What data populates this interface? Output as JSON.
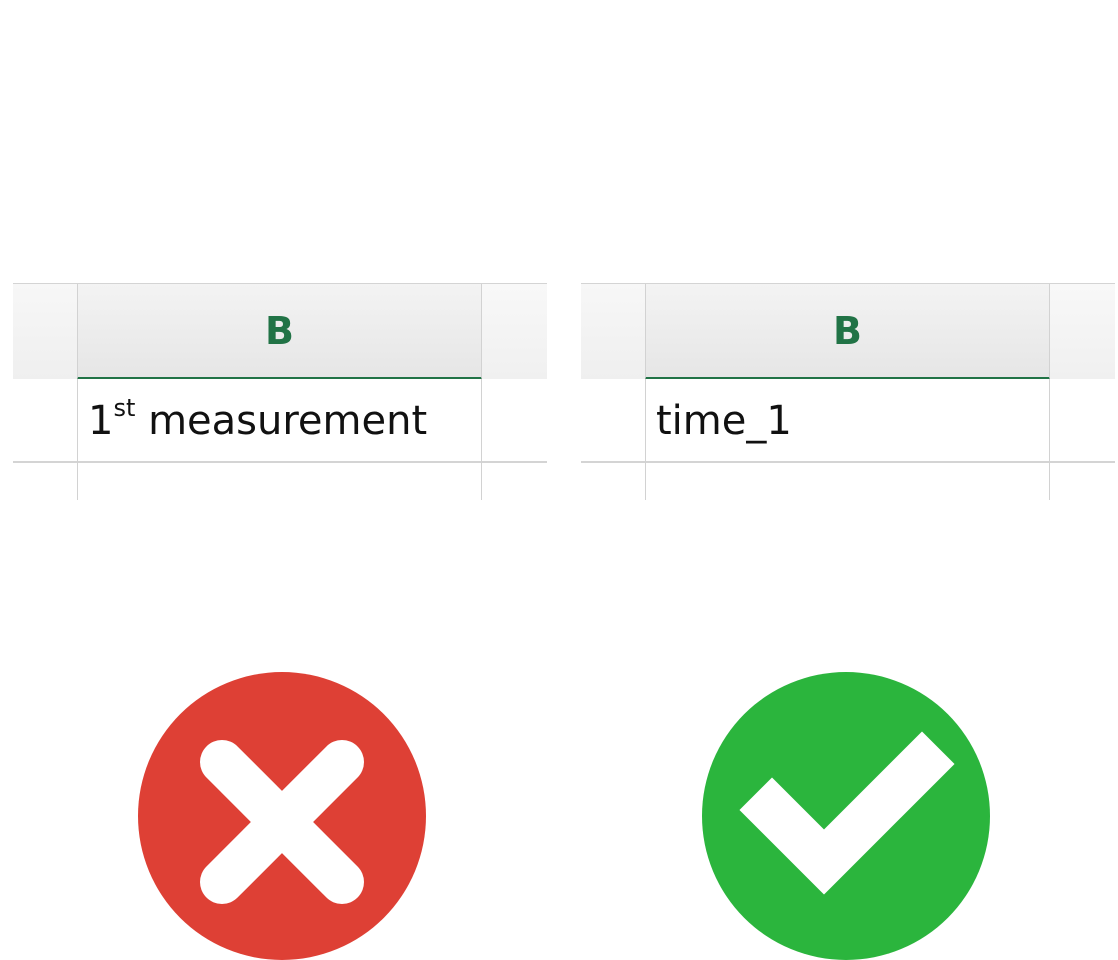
{
  "colors": {
    "header_accent": "#217346",
    "wrong": "#de4035",
    "right": "#2bb53d"
  },
  "examples": [
    {
      "verdict": "wrong",
      "column_letter": "B",
      "cell_value": "1",
      "cell_superscript": "st",
      "cell_value_rest": " measurement",
      "icon": "cross-icon"
    },
    {
      "verdict": "right",
      "column_letter": "B",
      "cell_value": "time_1",
      "icon": "check-icon"
    }
  ]
}
